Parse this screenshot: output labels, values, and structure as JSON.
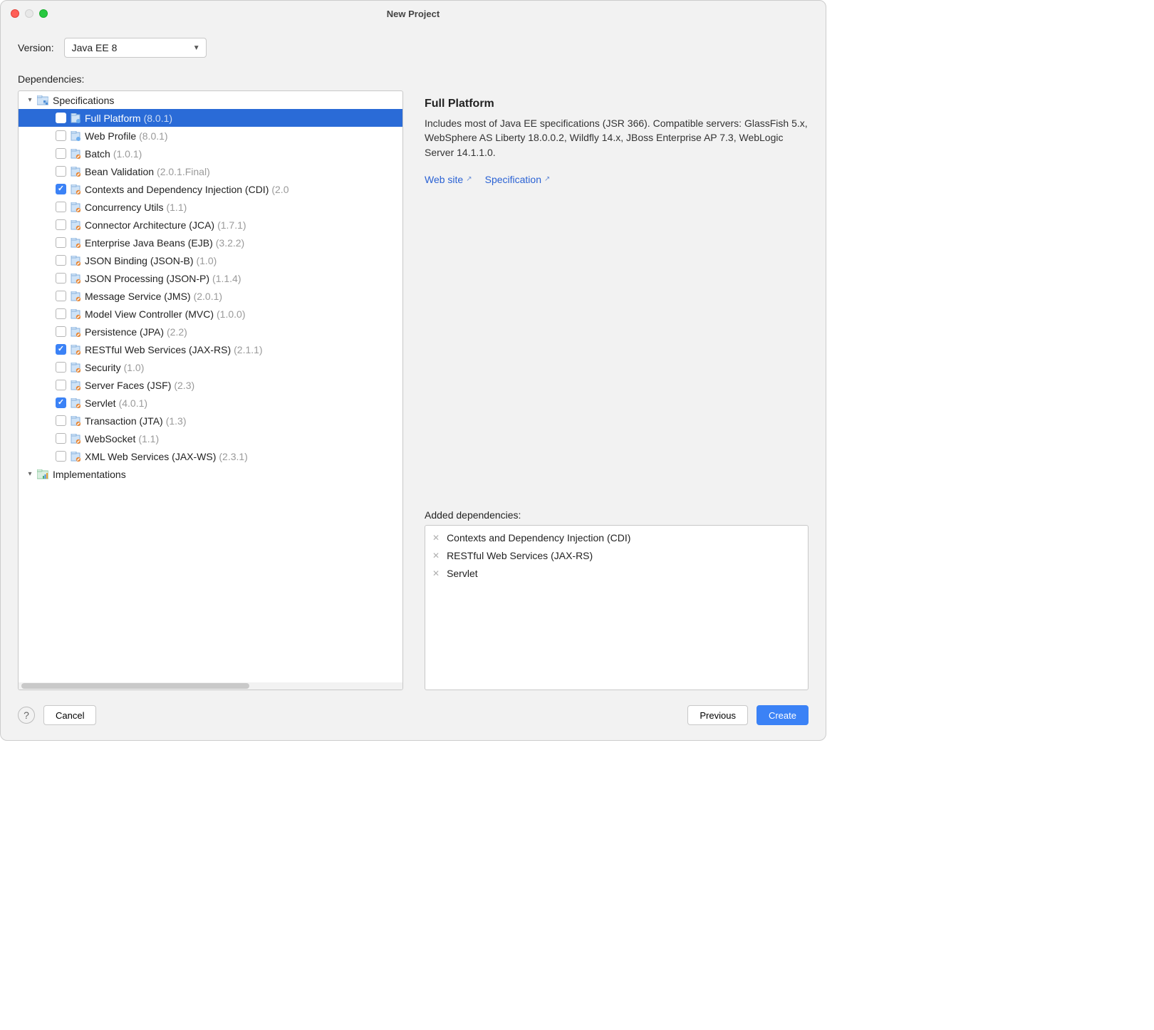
{
  "window": {
    "title": "New Project"
  },
  "version": {
    "label": "Version:",
    "value": "Java EE 8"
  },
  "deps": {
    "label": "Dependencies:"
  },
  "tree": {
    "groups": [
      {
        "label": "Specifications",
        "items": [
          {
            "label": "Full Platform",
            "ver": "(8.0.1)",
            "checked": false,
            "selected": true,
            "icon": "a"
          },
          {
            "label": "Web Profile",
            "ver": "(8.0.1)",
            "checked": false,
            "icon": "a"
          },
          {
            "label": "Batch",
            "ver": "(1.0.1)",
            "checked": false,
            "icon": "b"
          },
          {
            "label": "Bean Validation",
            "ver": "(2.0.1.Final)",
            "checked": false,
            "icon": "b"
          },
          {
            "label": "Contexts and Dependency Injection (CDI)",
            "ver": "(2.0",
            "checked": true,
            "icon": "b"
          },
          {
            "label": "Concurrency Utils",
            "ver": "(1.1)",
            "checked": false,
            "icon": "b"
          },
          {
            "label": "Connector Architecture (JCA)",
            "ver": "(1.7.1)",
            "checked": false,
            "icon": "b"
          },
          {
            "label": "Enterprise Java Beans (EJB)",
            "ver": "(3.2.2)",
            "checked": false,
            "icon": "b"
          },
          {
            "label": "JSON Binding (JSON-B)",
            "ver": "(1.0)",
            "checked": false,
            "icon": "b"
          },
          {
            "label": "JSON Processing (JSON-P)",
            "ver": "(1.1.4)",
            "checked": false,
            "icon": "b"
          },
          {
            "label": "Message Service (JMS)",
            "ver": "(2.0.1)",
            "checked": false,
            "icon": "b"
          },
          {
            "label": "Model View Controller (MVC)",
            "ver": "(1.0.0)",
            "checked": false,
            "icon": "b"
          },
          {
            "label": "Persistence (JPA)",
            "ver": "(2.2)",
            "checked": false,
            "icon": "b"
          },
          {
            "label": "RESTful Web Services (JAX-RS)",
            "ver": "(2.1.1)",
            "checked": true,
            "icon": "b"
          },
          {
            "label": "Security",
            "ver": "(1.0)",
            "checked": false,
            "icon": "b"
          },
          {
            "label": "Server Faces (JSF)",
            "ver": "(2.3)",
            "checked": false,
            "icon": "b"
          },
          {
            "label": "Servlet",
            "ver": "(4.0.1)",
            "checked": true,
            "icon": "b"
          },
          {
            "label": "Transaction (JTA)",
            "ver": "(1.3)",
            "checked": false,
            "icon": "b"
          },
          {
            "label": "WebSocket",
            "ver": "(1.1)",
            "checked": false,
            "icon": "b"
          },
          {
            "label": "XML Web Services (JAX-WS)",
            "ver": "(2.3.1)",
            "checked": false,
            "icon": "b"
          }
        ]
      },
      {
        "label": "Implementations",
        "items": []
      }
    ]
  },
  "detail": {
    "title": "Full Platform",
    "desc": "Includes most of Java EE specifications (JSR 366). Compatible servers: GlassFish 5.x, WebSphere AS Liberty 18.0.0.2, Wildfly 14.x, JBoss Enterprise AP 7.3, WebLogic Server 14.1.1.0.",
    "links": {
      "website": "Web site",
      "spec": "Specification"
    }
  },
  "added": {
    "label": "Added dependencies:",
    "items": [
      "Contexts and Dependency Injection (CDI)",
      "RESTful Web Services (JAX-RS)",
      "Servlet"
    ]
  },
  "footer": {
    "cancel": "Cancel",
    "previous": "Previous",
    "create": "Create"
  }
}
